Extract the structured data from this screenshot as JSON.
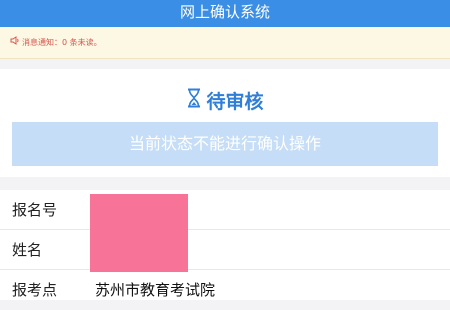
{
  "header": {
    "title": "网上确认系统"
  },
  "notice": {
    "icon": "speaker-icon",
    "text": "消息通知：0 条未读。"
  },
  "status": {
    "icon": "hourglass-icon",
    "title": "待审核",
    "banner": "当前状态不能进行确认操作"
  },
  "info": {
    "rows": [
      {
        "label": "报名号",
        "value": ""
      },
      {
        "label": "姓名",
        "value": ""
      },
      {
        "label": "报考点",
        "value": "苏州市教育考试院"
      }
    ]
  },
  "colors": {
    "header": "#3a8ee6",
    "notice_bg": "#fcf8e3",
    "notice_text": "#d8534c",
    "status_title": "#2f7ed8",
    "banner_bg": "#c5ddf6",
    "redaction": "#f77398"
  }
}
